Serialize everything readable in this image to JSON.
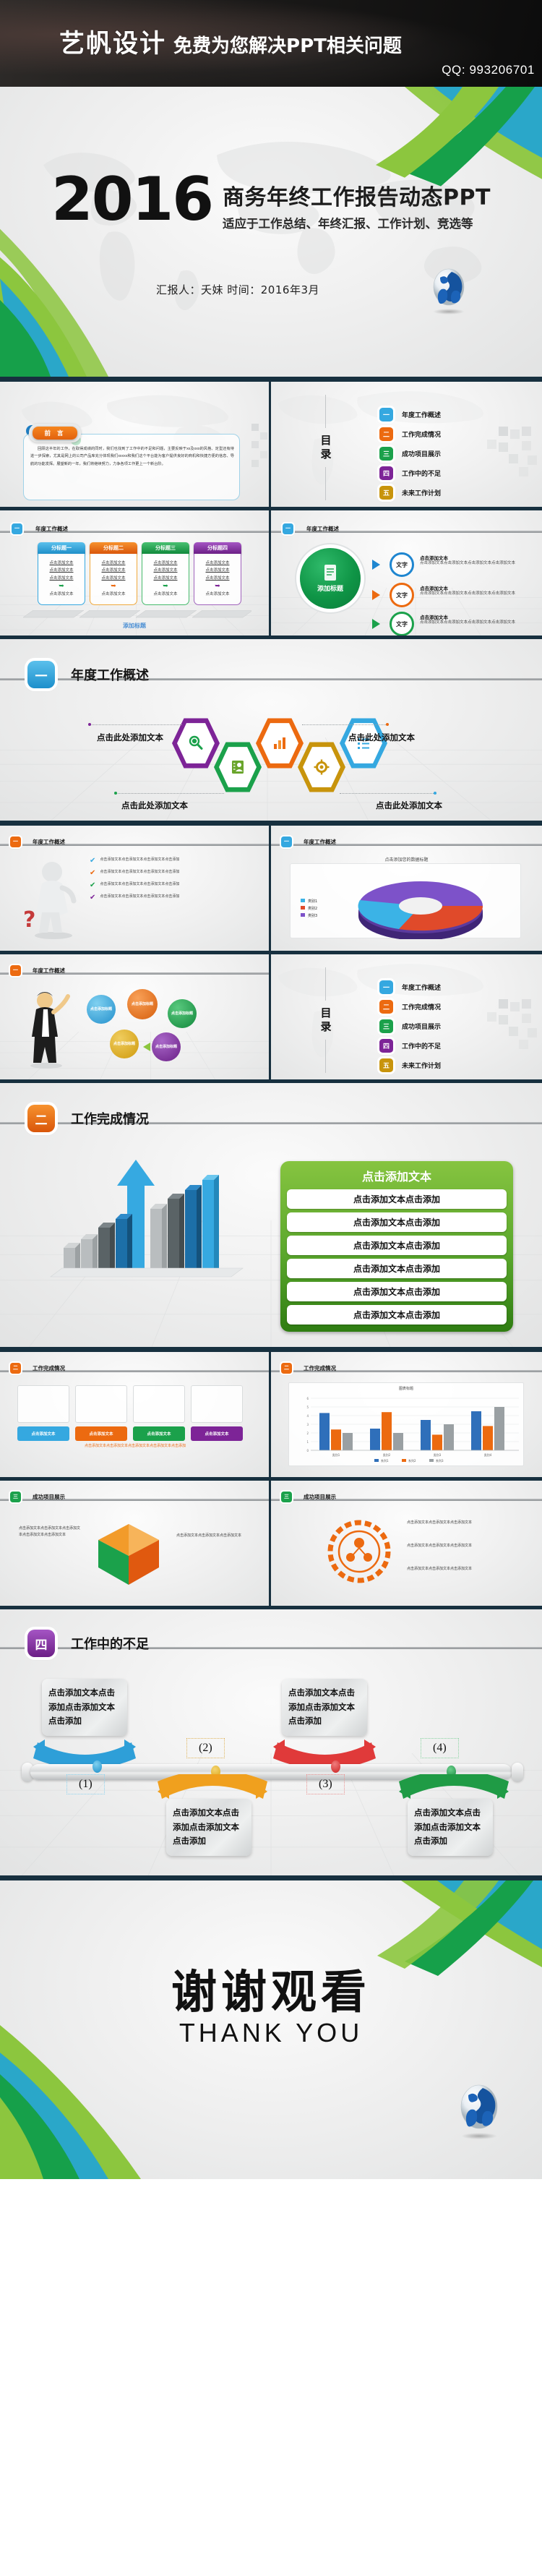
{
  "banner": {
    "brand": "艺帆设计",
    "tagline": "免费为您解决PPT相关问题",
    "qq": "QQ: 993206701"
  },
  "title_slide": {
    "year": "2016",
    "main_title": "商务年终工作报告动态PPT",
    "subtitle": "适应于工作总结、年终汇报、工作计划、竞选等",
    "byline": "汇报人：夭妹    时间：2016年3月",
    "globe_icon": "globe-icon"
  },
  "toc": {
    "label_line1": "目",
    "label_line2": "录",
    "items": [
      {
        "num": "一",
        "label": "年度工作概述",
        "color": "#34a7e0"
      },
      {
        "num": "二",
        "label": "工作完成情况",
        "color": "#ef6410"
      },
      {
        "num": "三",
        "label": "成功项目展示",
        "color": "#1ca04a"
      },
      {
        "num": "四",
        "label": "工作中的不足",
        "color": "#7d2497"
      },
      {
        "num": "五",
        "label": "未来工作计划",
        "color": "#c8940c"
      }
    ]
  },
  "foreword": {
    "tab": "前 言",
    "body": "回顾这半年的工作，在取得成绩的同时，我们也找到了工作中的不足和问题，主要反映于xx及xxx的风格、定型还有待进一步探索，尤其是网上的公司产品库充分体现我们xxxxx和我们这个平台能为客户提供良好的商机和快捷方便的信息、导航的功能发挥。展望新的一年，我们将继续努力，力争各项工作更上一个新台阶。"
  },
  "slide_cards4": {
    "section_badge": "一",
    "section_title": "年度工作概述",
    "caption": "添加标题",
    "cards": [
      {
        "head": "分标题一",
        "color": "#35a8e0",
        "lines": [
          "点击添加文本",
          "点击添加文本",
          "点击添加文本"
        ],
        "foot": "点击添加文本"
      },
      {
        "head": "分标题二",
        "color": "#ec6a10",
        "lines": [
          "点击添加文本",
          "点击添加文本",
          "点击添加文本"
        ],
        "foot": "点击添加文本"
      },
      {
        "head": "分标题三",
        "color": "#1ba14b",
        "lines": [
          "点击添加文本",
          "点击添加文本",
          "点击添加文本"
        ],
        "foot": "点击添加文本"
      },
      {
        "head": "分标题四",
        "color": "#7f2a9b",
        "lines": [
          "点击添加文本",
          "点击添加文本",
          "点击添加文本"
        ],
        "foot": "点击添加文本"
      }
    ]
  },
  "slide_circle": {
    "section_badge": "一",
    "section_title": "年度工作概述",
    "center_label": "添加标题",
    "center_icon": "document-icon",
    "bullets": [
      {
        "ring": "文字",
        "color": "#1f86d0",
        "title": "点击添加文本",
        "desc": "点击添加文本点击添加文本点击添加文本点击添加文本"
      },
      {
        "ring": "文字",
        "color": "#ec6a10",
        "title": "点击添加文本",
        "desc": "点击添加文本点击添加文本点击添加文本点击添加文本"
      },
      {
        "ring": "文字",
        "color": "#1ba14b",
        "title": "点击添加文本",
        "desc": "点击添加文本点击添加文本点击添加文本点击添加文本"
      }
    ]
  },
  "slide_hex": {
    "section_badge": "一",
    "section_title": "年度工作概述",
    "hexes": [
      {
        "color": "#7d2497",
        "icon": "search-icon"
      },
      {
        "color": "#1ba14b",
        "icon": "contact-card-icon"
      },
      {
        "color": "#ec6a10",
        "icon": "chart-icon"
      },
      {
        "color": "#c8940c",
        "icon": "gear-icon"
      },
      {
        "color": "#35a8e0",
        "icon": "list-icon"
      }
    ],
    "labels": [
      "点击此处添加文本",
      "点击此处添加文本",
      "点击此处添加文本",
      "点击此处添加文本"
    ]
  },
  "slide_people": {
    "section_badge": "一",
    "section_title": "年度工作概述",
    "rows": [
      {
        "icon": "check-icon",
        "color": "#35a8e0",
        "text": "点击添加文本点击添加文本点击添加文本点击添加"
      },
      {
        "icon": "check-icon",
        "color": "#ec6a10",
        "text": "点击添加文本点击添加文本点击添加文本点击添加"
      },
      {
        "icon": "check-icon",
        "color": "#1ba14b",
        "text": "点击添加文本点击添加文本点击添加文本点击添加"
      },
      {
        "icon": "check-icon",
        "color": "#7d2497",
        "text": "点击添加文本点击添加文本点击添加文本点击添加"
      }
    ]
  },
  "slide_pie": {
    "section_badge": "一",
    "section_title": "年度工作概述",
    "chart_title": "点击添加您的数据标题",
    "legend": [
      "类别1",
      "类别2",
      "类别3"
    ]
  },
  "slide_bubbles": {
    "section_badge": "一",
    "section_title": "年度工作概述",
    "bubbles": [
      {
        "text": "点击添加标题",
        "color": "#35a8e0"
      },
      {
        "text": "点击添加标题",
        "color": "#ec6a10"
      },
      {
        "text": "点击添加标题",
        "color": "#1ba14b"
      },
      {
        "text": "点击添加标题",
        "color": "#e0aa16"
      },
      {
        "text": "点击添加标题",
        "color": "#7d2497"
      }
    ]
  },
  "slide_green_list": {
    "section_badge": "二",
    "section_title": "工作完成情况",
    "header": "点击添加文本",
    "items": [
      "点击添加文本点击添加",
      "点击添加文本点击添加",
      "点击添加文本点击添加",
      "点击添加文本点击添加",
      "点击添加文本点击添加",
      "点击添加文本点击添加"
    ]
  },
  "slide_4tiles": {
    "section_badge": "二",
    "section_title": "工作完成情况",
    "tiles": [
      {
        "label": "点击添加文本",
        "color": "#35a8e0"
      },
      {
        "label": "点击添加文本",
        "color": "#ec6a10"
      },
      {
        "label": "点击添加文本",
        "color": "#1ba14b"
      },
      {
        "label": "点击添加文本",
        "color": "#7d2497"
      }
    ],
    "footer": "点击添加文本点击添加文本点击添加文本点击添加文本点击添加"
  },
  "slide_barchart": {
    "section_badge": "二",
    "section_title": "工作完成情况",
    "chart_data": {
      "type": "bar",
      "title": "图表标题",
      "categories": [
        "类别1",
        "类别2",
        "类别3",
        "类别4"
      ],
      "series": [
        {
          "name": "系列1",
          "color": "#2f6fba",
          "values": [
            4.3,
            2.5,
            3.5,
            4.5
          ]
        },
        {
          "name": "系列2",
          "color": "#ec6a10",
          "values": [
            2.4,
            4.4,
            1.8,
            2.8
          ]
        },
        {
          "name": "系列3",
          "color": "#9aa0a3",
          "values": [
            2.0,
            2.0,
            3.0,
            5.0
          ]
        }
      ],
      "ylim": [
        0,
        6
      ],
      "yticks": [
        "0",
        "1",
        "2",
        "3",
        "4",
        "5",
        "6"
      ],
      "grid": true,
      "legend": "bottom"
    }
  },
  "slide_cube": {
    "section_badge": "三",
    "section_title": "成功项目展示",
    "left_text": "点击添加文本点击添加文本点击添加文本点击添加文本点击添加文本",
    "right_text": "点击添加文本点击添加文本点击添加文本"
  },
  "slide_orgring": {
    "section_badge": "三",
    "section_title": "成功项目展示",
    "texts": [
      "点击添加文本点击添加文本点击添加文本",
      "点击添加文本点击添加文本点击添加文本",
      "点击添加文本点击添加文本点击添加文本"
    ]
  },
  "slide_timeline": {
    "section_badge": "四",
    "section_title": "工作中的不足",
    "markers": [
      "(1)",
      "(2)",
      "(3)",
      "(4)"
    ],
    "nodes": [
      {
        "color": "#35a8e0"
      },
      {
        "color": "#e5b62a"
      },
      {
        "color": "#e03a3a"
      },
      {
        "color": "#27a145"
      }
    ],
    "boxes": [
      {
        "color": "#35a8e0",
        "side": "top",
        "text": "点击添加文本点击添加点击添加文本点击添加"
      },
      {
        "color": "#e5b62a",
        "side": "bottom",
        "text": "点击添加文本点击添加点击添加文本点击添加"
      },
      {
        "color": "#e03a3a",
        "side": "top",
        "text": "点击添加文本点击添加点击添加文本点击添加"
      },
      {
        "color": "#27a145",
        "side": "bottom",
        "text": "点击添加文本点击添加点击添加文本点击添加"
      }
    ]
  },
  "thankyou": {
    "cn": "谢谢观看",
    "en": "THANK YOU",
    "globe_icon": "globe-icon"
  },
  "colors": {
    "dark_bar": "#17303f",
    "blue": "#35a8e0",
    "orange": "#ec6a10",
    "green": "#1ba14b",
    "purple": "#7d2497",
    "gold": "#c8940c"
  }
}
